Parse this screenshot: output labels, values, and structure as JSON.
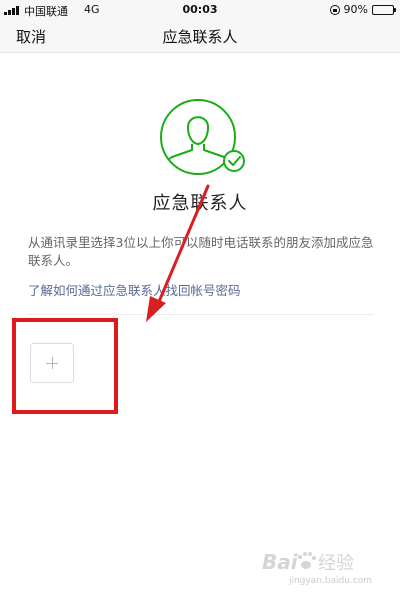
{
  "status_bar": {
    "carrier": "中国联通",
    "network": "4G",
    "time": "00:03",
    "battery_percent": "90%",
    "battery_level": 0.9
  },
  "nav": {
    "cancel_label": "取消",
    "title": "应急联系人"
  },
  "hero": {
    "icon": "person-shield-icon",
    "title": "应急联系人",
    "accent_color": "#1aad19"
  },
  "description": "从通讯录里选择3位以上你可以随时电话联系的朋友添加成应急联系人。",
  "help_link": "了解如何通过应急联系人找回帐号密码",
  "add_contact": {
    "icon": "plus-icon"
  },
  "annotation": {
    "highlight_color": "#e0191c",
    "arrow_color": "#d71f24"
  },
  "watermark": {
    "brand": "Baidu经验",
    "url": "jingyan.baidu.com"
  }
}
